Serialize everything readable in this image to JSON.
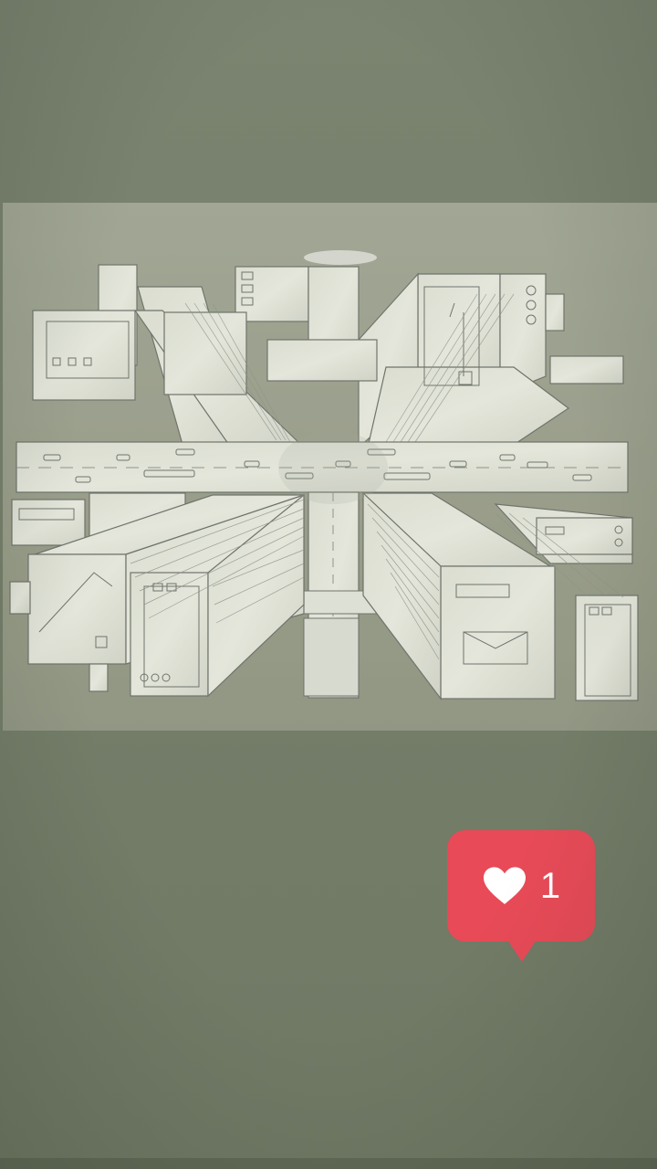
{
  "story": {
    "like_badge": {
      "icon": "heart-icon",
      "count": "1",
      "color": "#e84a57"
    }
  }
}
